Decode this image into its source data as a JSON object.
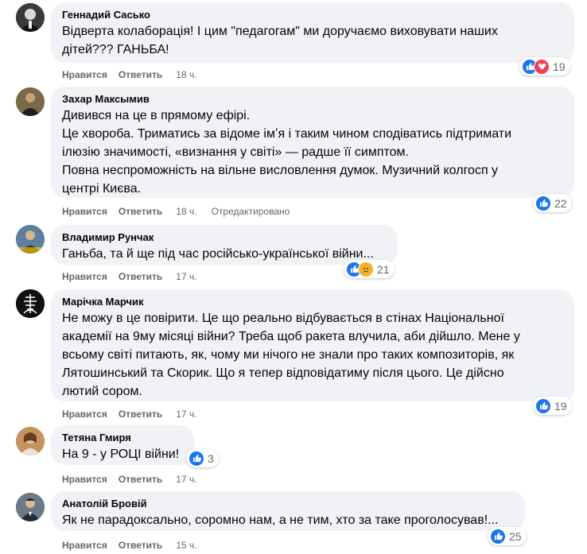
{
  "colors": {
    "like": "#1877f2",
    "love": "#f33e58",
    "sad": "#f7b125",
    "bubble": "#f0f2f5",
    "meta": "#65676b"
  },
  "actions": {
    "like_label": "Нравится",
    "reply_label": "Ответить"
  },
  "comments": [
    {
      "author": "Геннадий Сасько",
      "lines": [
        "Відверта колаборація! І цим \"педагогам\" ми доручаємо виховувати наших",
        "дітей??? ГАНЬБА!"
      ],
      "time": "18 ч.",
      "edited": "",
      "reactions": [
        "like-icon",
        "love-icon"
      ],
      "count": "19"
    },
    {
      "author": "Захар Максымив",
      "lines": [
        "Дивився на це в прямому ефірі.",
        "Це хвороба. Триматись за відоме імʼя і таким чином сподіватись підтримати",
        "ілюзію значимості, «визнання у світі» — радше її симптом.",
        "Повна неспроможність на вільне висловлення думок. Музичний колгосп у",
        "центрі Києва."
      ],
      "time": "18 ч.",
      "edited": "Отредактировано",
      "reactions": [
        "like-icon"
      ],
      "count": "22"
    },
    {
      "author": "Владимир Рунчак",
      "lines": [
        "Ганьба, та й ще під час російсько-української війни..."
      ],
      "time": "17 ч.",
      "edited": "",
      "reactions": [
        "like-icon",
        "sad-icon"
      ],
      "count": "21"
    },
    {
      "author": "Марічка Марчик",
      "lines": [
        "Не можу в це повірити. Це що реально відбувається в стінах Національної",
        "академії на 9му місяці війни? Треба щоб ракета влучила, аби дійшло. Мене у",
        "всьому світі питають, як, чому ми нічого не знали про таких композиторів, як",
        "Лятошинський та Скорик. Що я тепер відповідатиму після цього. Це дійсно",
        "лютий сором."
      ],
      "time": "17 ч.",
      "edited": "",
      "reactions": [
        "like-icon"
      ],
      "count": "19"
    },
    {
      "author": "Тетяна Гмиря",
      "lines": [
        "На 9 - у РОЦІ війни!"
      ],
      "time": "17 ч.",
      "edited": "",
      "reactions": [
        "like-icon"
      ],
      "count": "3"
    },
    {
      "author": "Анатолій Бровій",
      "lines": [
        "Як не парадоксально, соромно нам, а не тим, хто за таке проголосував!..."
      ],
      "time": "15 ч.",
      "edited": "",
      "reactions": [
        "like-icon"
      ],
      "count": "25"
    }
  ]
}
